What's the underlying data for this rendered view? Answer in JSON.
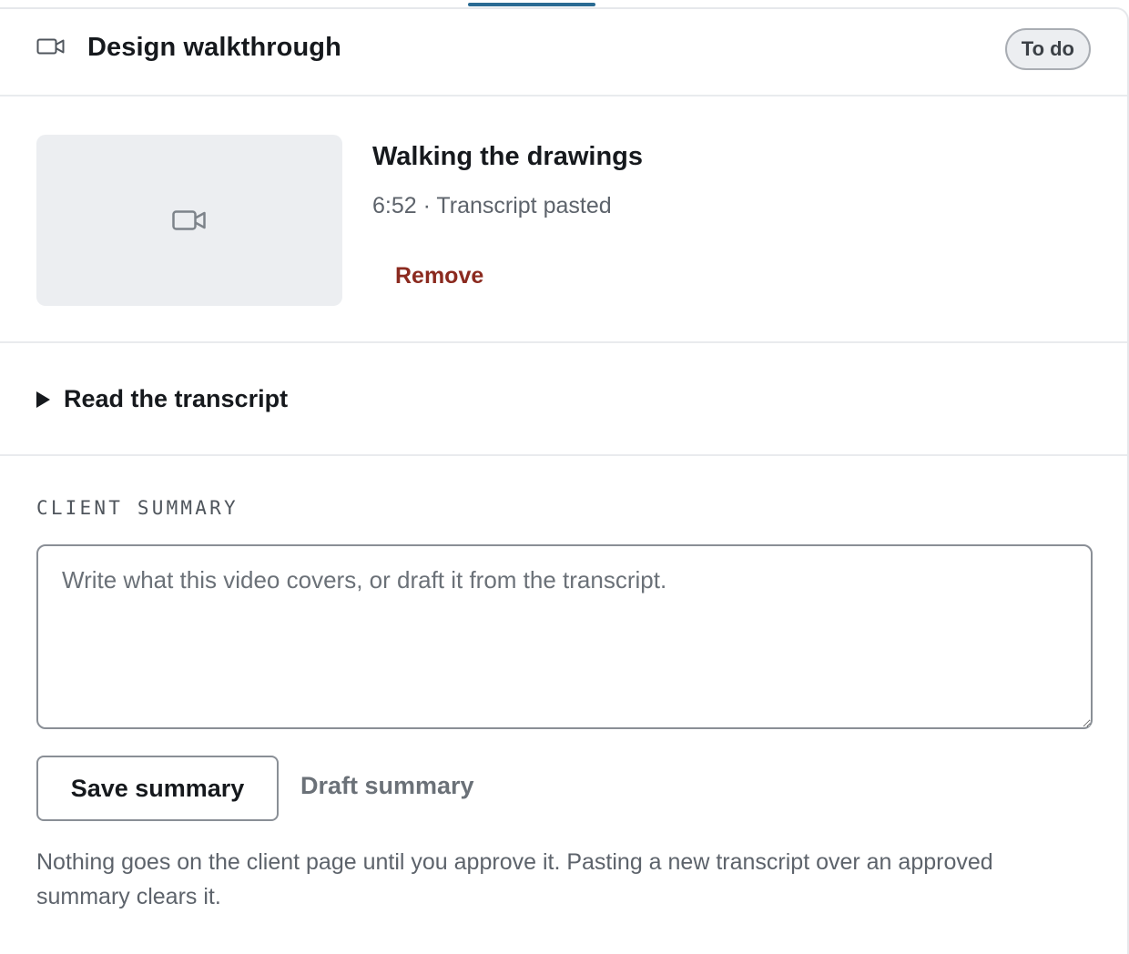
{
  "header": {
    "title": "Design walkthrough",
    "status": "To do",
    "icon": "video-camera-icon"
  },
  "video": {
    "title": "Walking the drawings",
    "meta": "6:52 · Transcript pasted",
    "remove_label": "Remove",
    "thumbnail_icon": "video-camera-icon"
  },
  "transcript": {
    "label": "Read the transcript",
    "expanded": false
  },
  "summary": {
    "section_label": "CLIENT SUMMARY",
    "placeholder": "Write what this video covers, or draft it from the transcript.",
    "value": "",
    "save_label": "Save summary",
    "draft_label": "Draft summary",
    "help_text": "Nothing goes on the client page until you approve it. Pasting a new transcript over an approved summary clears it."
  },
  "colors": {
    "accent": "#2a6b93",
    "danger": "#8b2a1f",
    "muted": "#5d636b"
  }
}
